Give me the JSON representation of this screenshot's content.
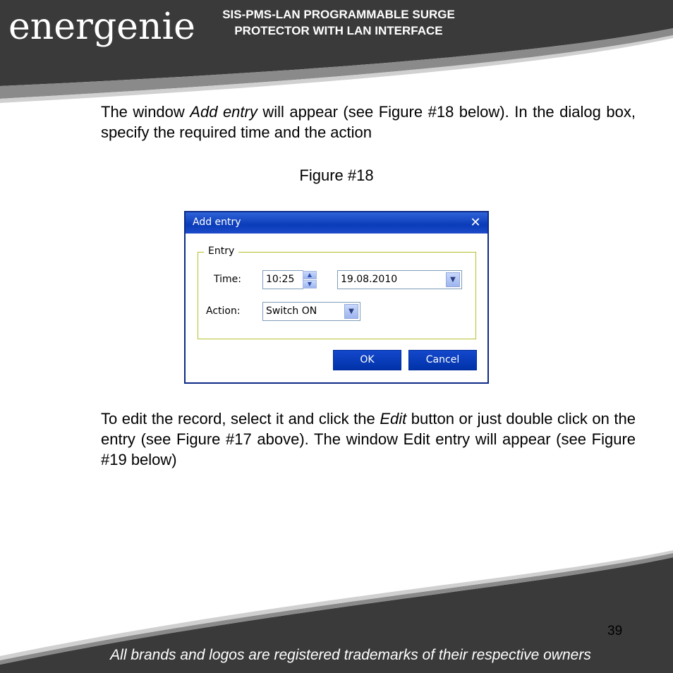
{
  "header": {
    "logo_text": "energenie",
    "title_line1": "SIS-PMS-LAN PROGRAMMABLE SURGE",
    "title_line2": "PROTECTOR WITH LAN INTERFACE"
  },
  "para1": {
    "pre": "The window ",
    "em": "Add entry",
    "post": " will appear (see Figure #18 below). In the dialog box, specify the required time and the action"
  },
  "figure_caption": "Figure #18",
  "dialog": {
    "title": "Add entry",
    "close_glyph": "✕",
    "group_label": "Entry",
    "time_label": "Time:",
    "time_value": "10:25",
    "date_value": "19.08.2010",
    "action_label": "Action:",
    "action_value": "Switch ON",
    "ok_label": "OK",
    "cancel_label": "Cancel",
    "accent_color": "#0a3bb8"
  },
  "para2": {
    "pre": "To edit the record, select it and click the ",
    "em": "Edit",
    "post": " button or just double click on the entry (see Figure #17 above). The window Edit entry will appear  (see Figure #19 below)"
  },
  "footer": {
    "page_number": "39",
    "trademark_text": "All brands and logos are registered trademarks of their respective owners"
  }
}
